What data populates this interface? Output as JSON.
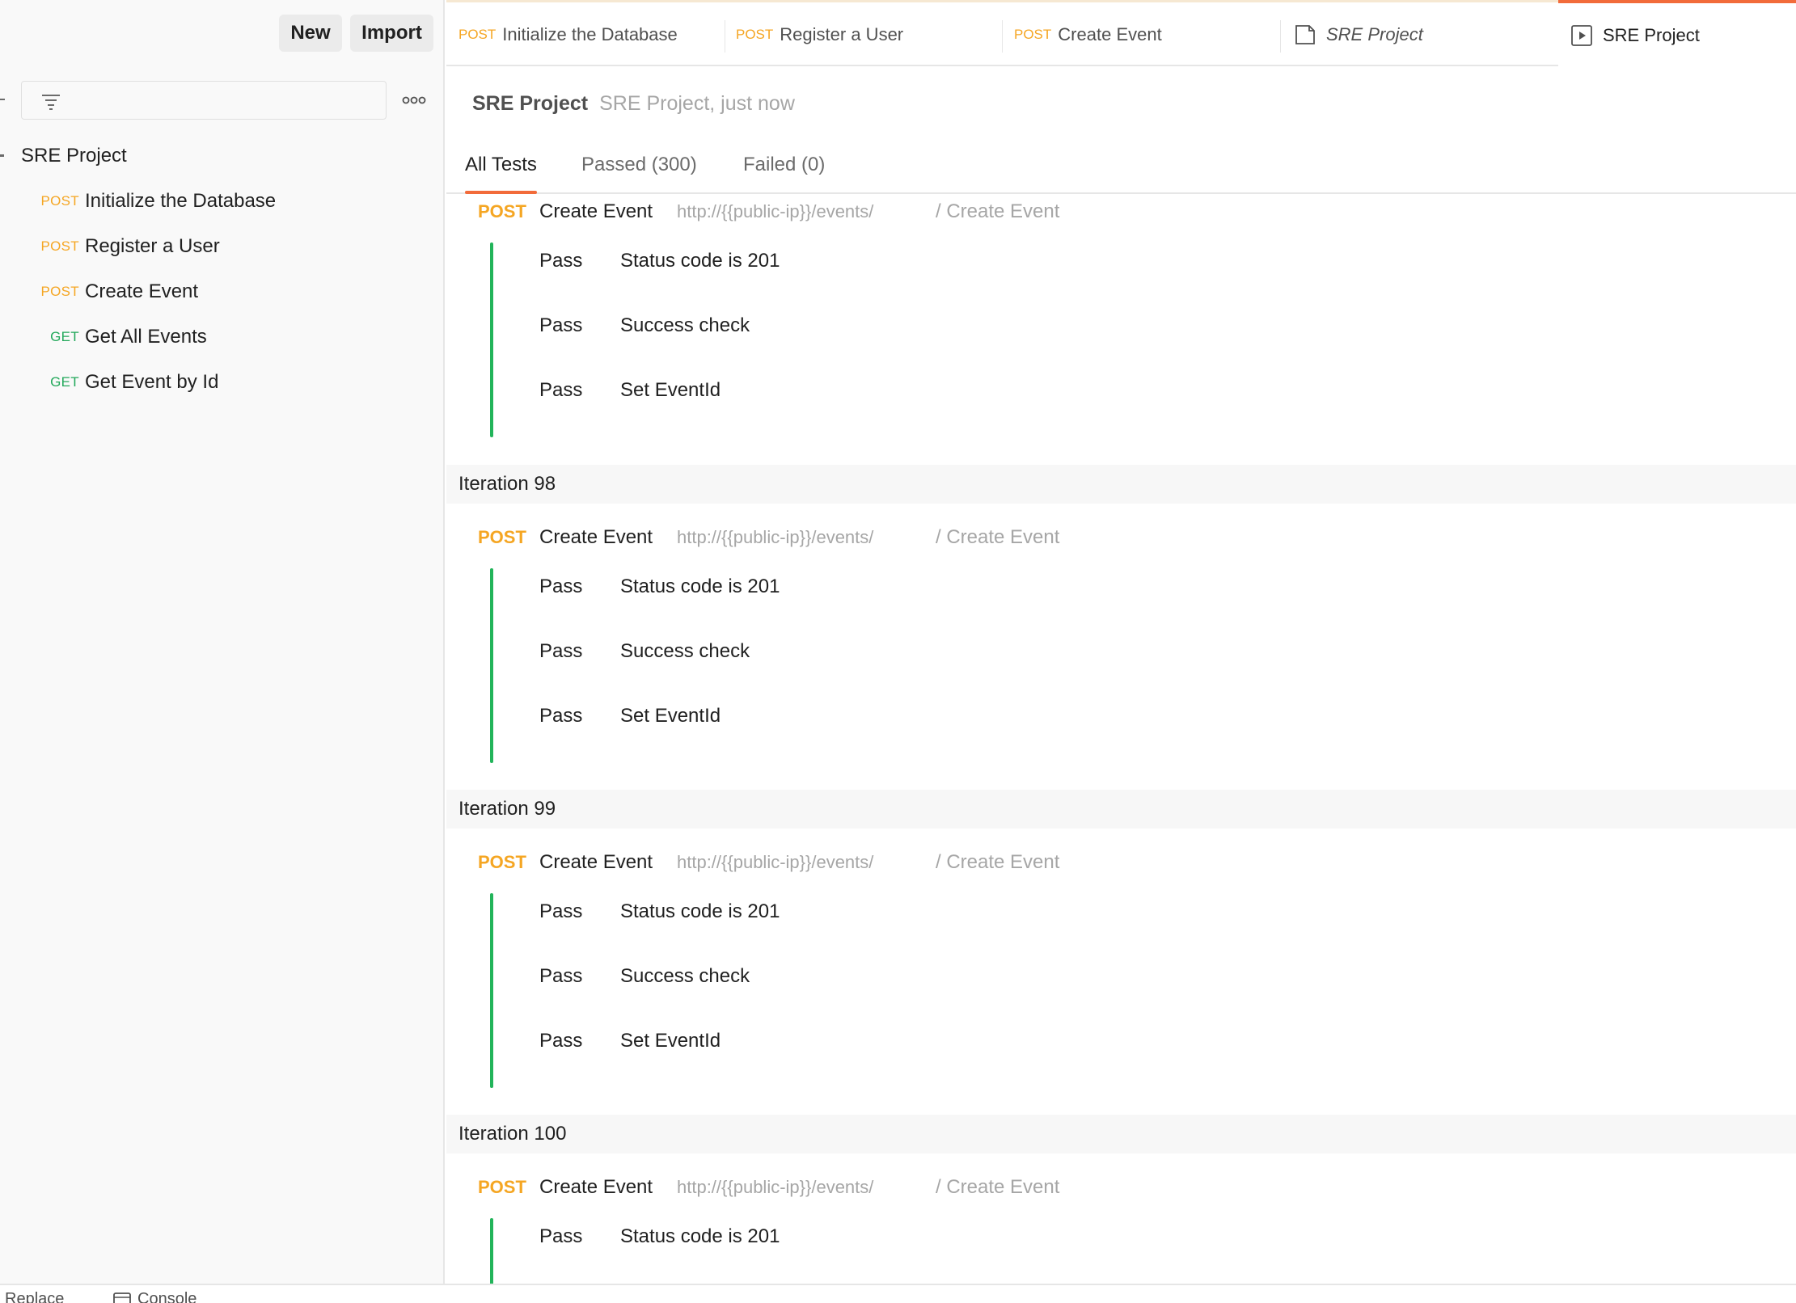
{
  "sidebar": {
    "new_label": "New",
    "import_label": "Import",
    "filter_placeholder": "",
    "collection": {
      "name": "SRE Project",
      "requests": [
        {
          "method": "POST",
          "name": "Initialize the Database"
        },
        {
          "method": "POST",
          "name": "Register a User"
        },
        {
          "method": "POST",
          "name": "Create Event"
        },
        {
          "method": "GET",
          "name": "Get All Events"
        },
        {
          "method": "GET",
          "name": "Get Event by Id"
        }
      ]
    }
  },
  "tabs": [
    {
      "method": "POST",
      "label": "Initialize the Database",
      "kind": "request"
    },
    {
      "method": "POST",
      "label": "Register a User",
      "kind": "request"
    },
    {
      "method": "POST",
      "label": "Create Event",
      "kind": "request"
    },
    {
      "method": "",
      "label": "SRE Project",
      "kind": "collection"
    },
    {
      "method": "",
      "label": "SRE Project",
      "kind": "runner",
      "active": true
    }
  ],
  "runner": {
    "title": "SRE Project",
    "subtitle": "SRE Project, just now",
    "result_tabs": [
      "All Tests",
      "Passed (300)",
      "Failed (0)"
    ],
    "active_result_tab": "All Tests"
  },
  "results": {
    "request": {
      "method": "POST",
      "name": "Create Event",
      "url": "http://{{public-ip}}/events/",
      "path": "/ Create Event"
    },
    "top_block": {
      "tests": [
        {
          "status": "Pass",
          "name": "Status code is 201"
        },
        {
          "status": "Pass",
          "name": "Success check"
        },
        {
          "status": "Pass",
          "name": "Set EventId"
        }
      ]
    },
    "iterations": [
      {
        "label": "Iteration 98",
        "tests": [
          {
            "status": "Pass",
            "name": "Status code is 201"
          },
          {
            "status": "Pass",
            "name": "Success check"
          },
          {
            "status": "Pass",
            "name": "Set EventId"
          }
        ]
      },
      {
        "label": "Iteration 99",
        "tests": [
          {
            "status": "Pass",
            "name": "Status code is 201"
          },
          {
            "status": "Pass",
            "name": "Success check"
          },
          {
            "status": "Pass",
            "name": "Set EventId"
          }
        ]
      },
      {
        "label": "Iteration 100",
        "tests": [
          {
            "status": "Pass",
            "name": "Status code is 201"
          }
        ]
      }
    ]
  },
  "statusbar": {
    "left_label": "Replace",
    "console_label": "Console"
  },
  "colors": {
    "post": "#f5a623",
    "get": "#22a85a",
    "pass_bar": "#22b45a",
    "accent": "#f26b3a"
  }
}
